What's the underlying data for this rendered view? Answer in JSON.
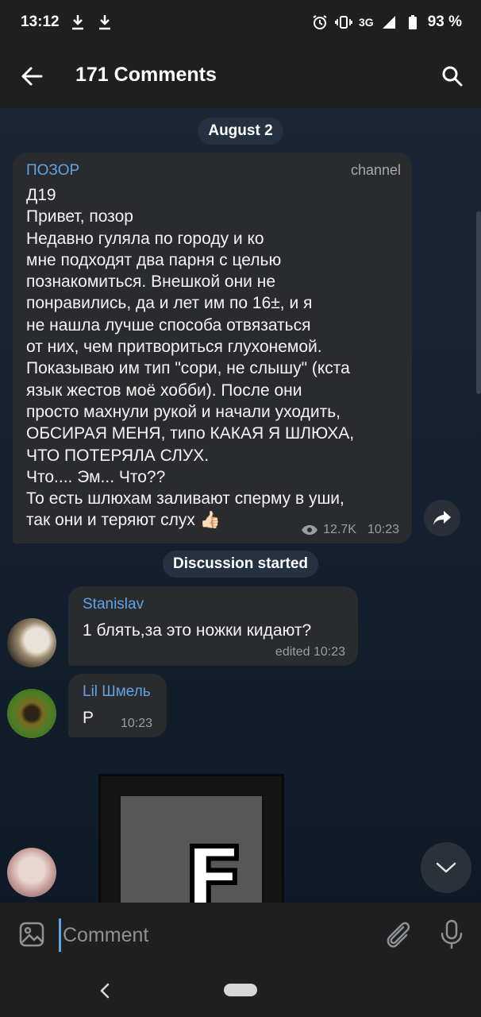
{
  "status_bar": {
    "time": "13:12",
    "network": "3G",
    "battery": "93 %",
    "icons": [
      "download-icon",
      "download-icon",
      "alarm-icon",
      "vibrate-icon",
      "signal-icon",
      "battery-icon"
    ]
  },
  "app_bar": {
    "title": "171 Comments",
    "icons": [
      "back-arrow-icon",
      "search-icon"
    ]
  },
  "chat": {
    "date_label": "August 2",
    "post": {
      "author": "ПОЗОР",
      "tag": "channel",
      "text": "Д19\nПривет, позор\nНедавно гуляла по городу и ко\nмне подходят два парня с целью\nпознакомиться. Внешкой они не\nпонравились, да и лет им по 16±, и я\nне нашла лучше способа отвязаться\nот них, чем притвориться глухонемой.\nПоказываю им тип \"сори, не слышу\" (кста\nязык жестов моё хобби). После они\nпросто махнули рукой и начали уходить,\nОБСИРАЯ МЕНЯ, типо КАКАЯ Я ШЛЮХА,\nЧТО ПОТЕРЯЛА СЛУХ.\nЧто.... Эм... Что??\nТо есть шлюхам заливают сперму в уши,\nтак они и теряют слух 👍🏻",
      "views": "12.7K",
      "time": "10:23"
    },
    "discussion_label": "Discussion started",
    "messages": [
      {
        "sender": "Stanislav",
        "text": "1 блять,за это ножки кидают?",
        "time": "edited 10:23"
      },
      {
        "sender": "Lil Шмель",
        "text": "P",
        "time": "10:23"
      }
    ],
    "sticker_letter": "F"
  },
  "input": {
    "placeholder": "Comment"
  },
  "colors": {
    "accent": "#5fa3e5",
    "bubble": "#2a2b2e",
    "bar": "#1f1f1f"
  }
}
